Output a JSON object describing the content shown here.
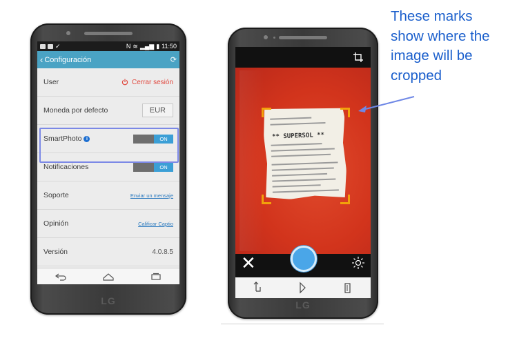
{
  "settings_screen": {
    "status_time": "11:50",
    "title": "Configuración",
    "rows": {
      "user": {
        "label": "User",
        "action": "Cerrar sesión"
      },
      "currency": {
        "label": "Moneda por defecto",
        "value": "EUR"
      },
      "smartphoto": {
        "label": "SmartPhoto",
        "toggle": "ON"
      },
      "notifications": {
        "label": "Notificaciones",
        "toggle": "ON"
      },
      "support": {
        "label": "Soporte",
        "link": "Enviar un mensaje"
      },
      "opinion": {
        "label": "Opinión",
        "link": "Calificar Captio"
      },
      "version": {
        "label": "Versión",
        "value": "4.0.8.5"
      }
    }
  },
  "camera_screen": {
    "receipt_shop": "** SUPERSOL **"
  },
  "annotation": {
    "text": "These marks show where the image will be cropped"
  },
  "brand": "LG",
  "colors": {
    "accent": "#4aa3c4",
    "toggle_on": "#3b9fd6",
    "logout": "#e0483e",
    "crop_marks": "#f2a20b",
    "annotation": "#1b5fcc",
    "highlight": "#7b88e6"
  }
}
